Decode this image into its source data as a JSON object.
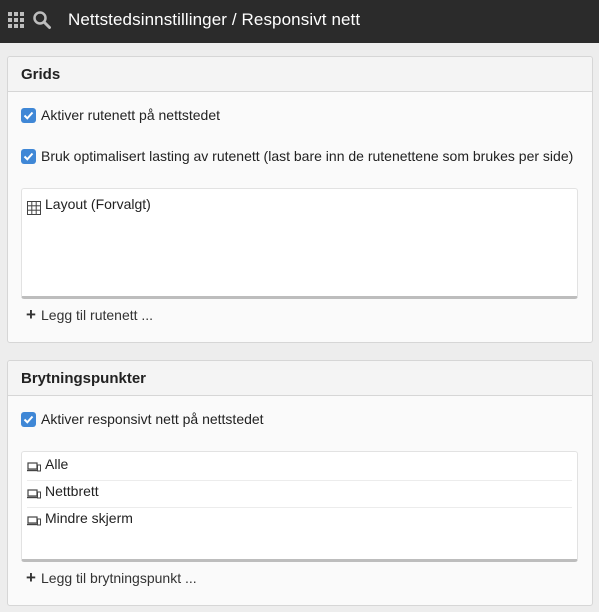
{
  "header": {
    "apps_icon": "apps-grid-icon",
    "search_icon": "search-icon",
    "title": "Nettstedsinnstillinger / Responsivt nett"
  },
  "grids": {
    "title": "Grids",
    "enable_grid_label": "Aktiver rutenett på nettstedet",
    "enable_grid_checked": true,
    "optimized_label": "Bruk optimalisert lasting av rutenett (last bare inn de rutenettene som brukes per side)",
    "optimized_checked": true,
    "items": [
      {
        "label": "Layout (Forvalgt)",
        "icon": "table-grid-icon"
      }
    ],
    "add_label": "Legg til rutenett ..."
  },
  "breakpoints": {
    "title": "Brytningspunkter",
    "enable_label": "Aktiver responsivt nett på nettstedet",
    "enable_checked": true,
    "items": [
      {
        "label": "Alle",
        "icon": "devices-icon"
      },
      {
        "label": "Nettbrett",
        "icon": "devices-icon"
      },
      {
        "label": "Mindre skjerm",
        "icon": "devices-icon"
      }
    ],
    "add_label": "Legg til brytningspunkt ..."
  },
  "colors": {
    "topbar": "#2b2b2b",
    "checkbox": "#3f87d6",
    "background": "#ededed"
  }
}
